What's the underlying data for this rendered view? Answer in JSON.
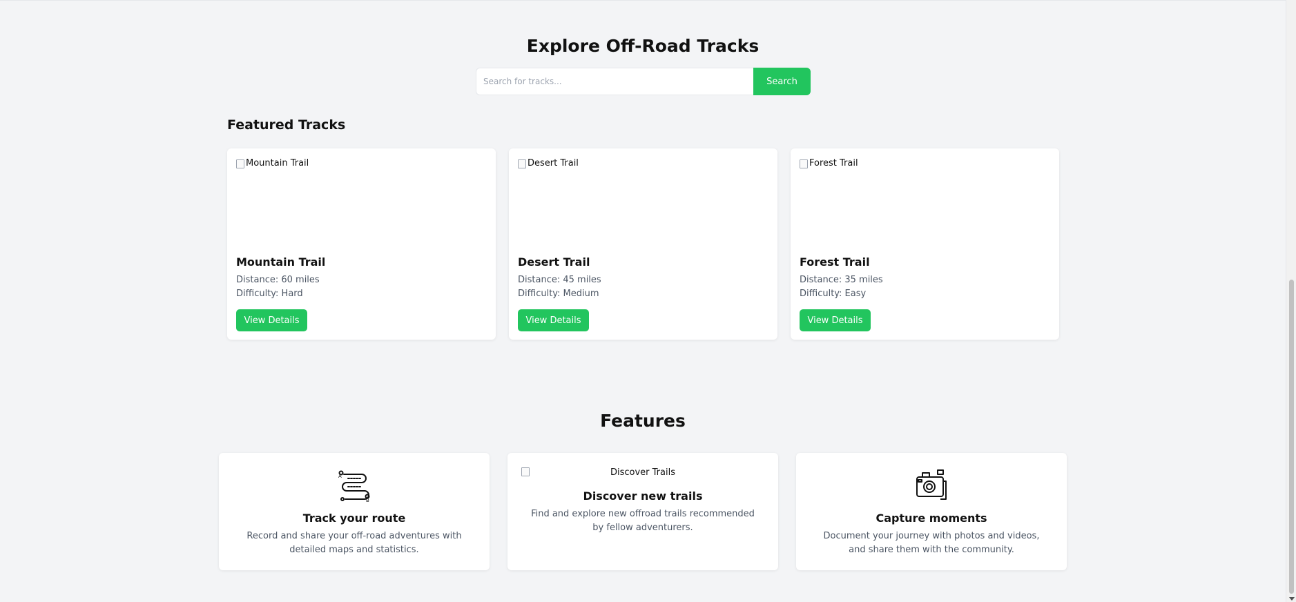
{
  "explore": {
    "title": "Explore Off-Road Tracks",
    "search_placeholder": "Search for tracks...",
    "search_button": "Search"
  },
  "featured": {
    "heading": "Featured Tracks",
    "tracks": [
      {
        "image_alt": "Mountain Trail",
        "name": "Mountain Trail",
        "distance": "Distance: 60 miles",
        "difficulty": "Difficulty: Hard",
        "button": "View Details"
      },
      {
        "image_alt": "Desert Trail",
        "name": "Desert Trail",
        "distance": "Distance: 45 miles",
        "difficulty": "Difficulty: Medium",
        "button": "View Details"
      },
      {
        "image_alt": "Forest Trail",
        "name": "Forest Trail",
        "distance": "Distance: 35 miles",
        "difficulty": "Difficulty: Easy",
        "button": "View Details"
      }
    ]
  },
  "features": {
    "title": "Features",
    "items": [
      {
        "icon": "route-icon",
        "title": "Track your route",
        "description": "Record and share your off-road adventures with detailed maps and statistics."
      },
      {
        "image_alt": "Discover Trails",
        "title": "Discover new trails",
        "description": "Find and explore new offroad trails recommended by fellow adventurers."
      },
      {
        "icon": "camera-icon",
        "title": "Capture moments",
        "description": "Document your journey with photos and videos, and share them with the community."
      }
    ]
  },
  "colors": {
    "accent": "#22c55e",
    "background": "#f3f4f6",
    "card": "#ffffff",
    "muted_text": "#4b5563"
  }
}
